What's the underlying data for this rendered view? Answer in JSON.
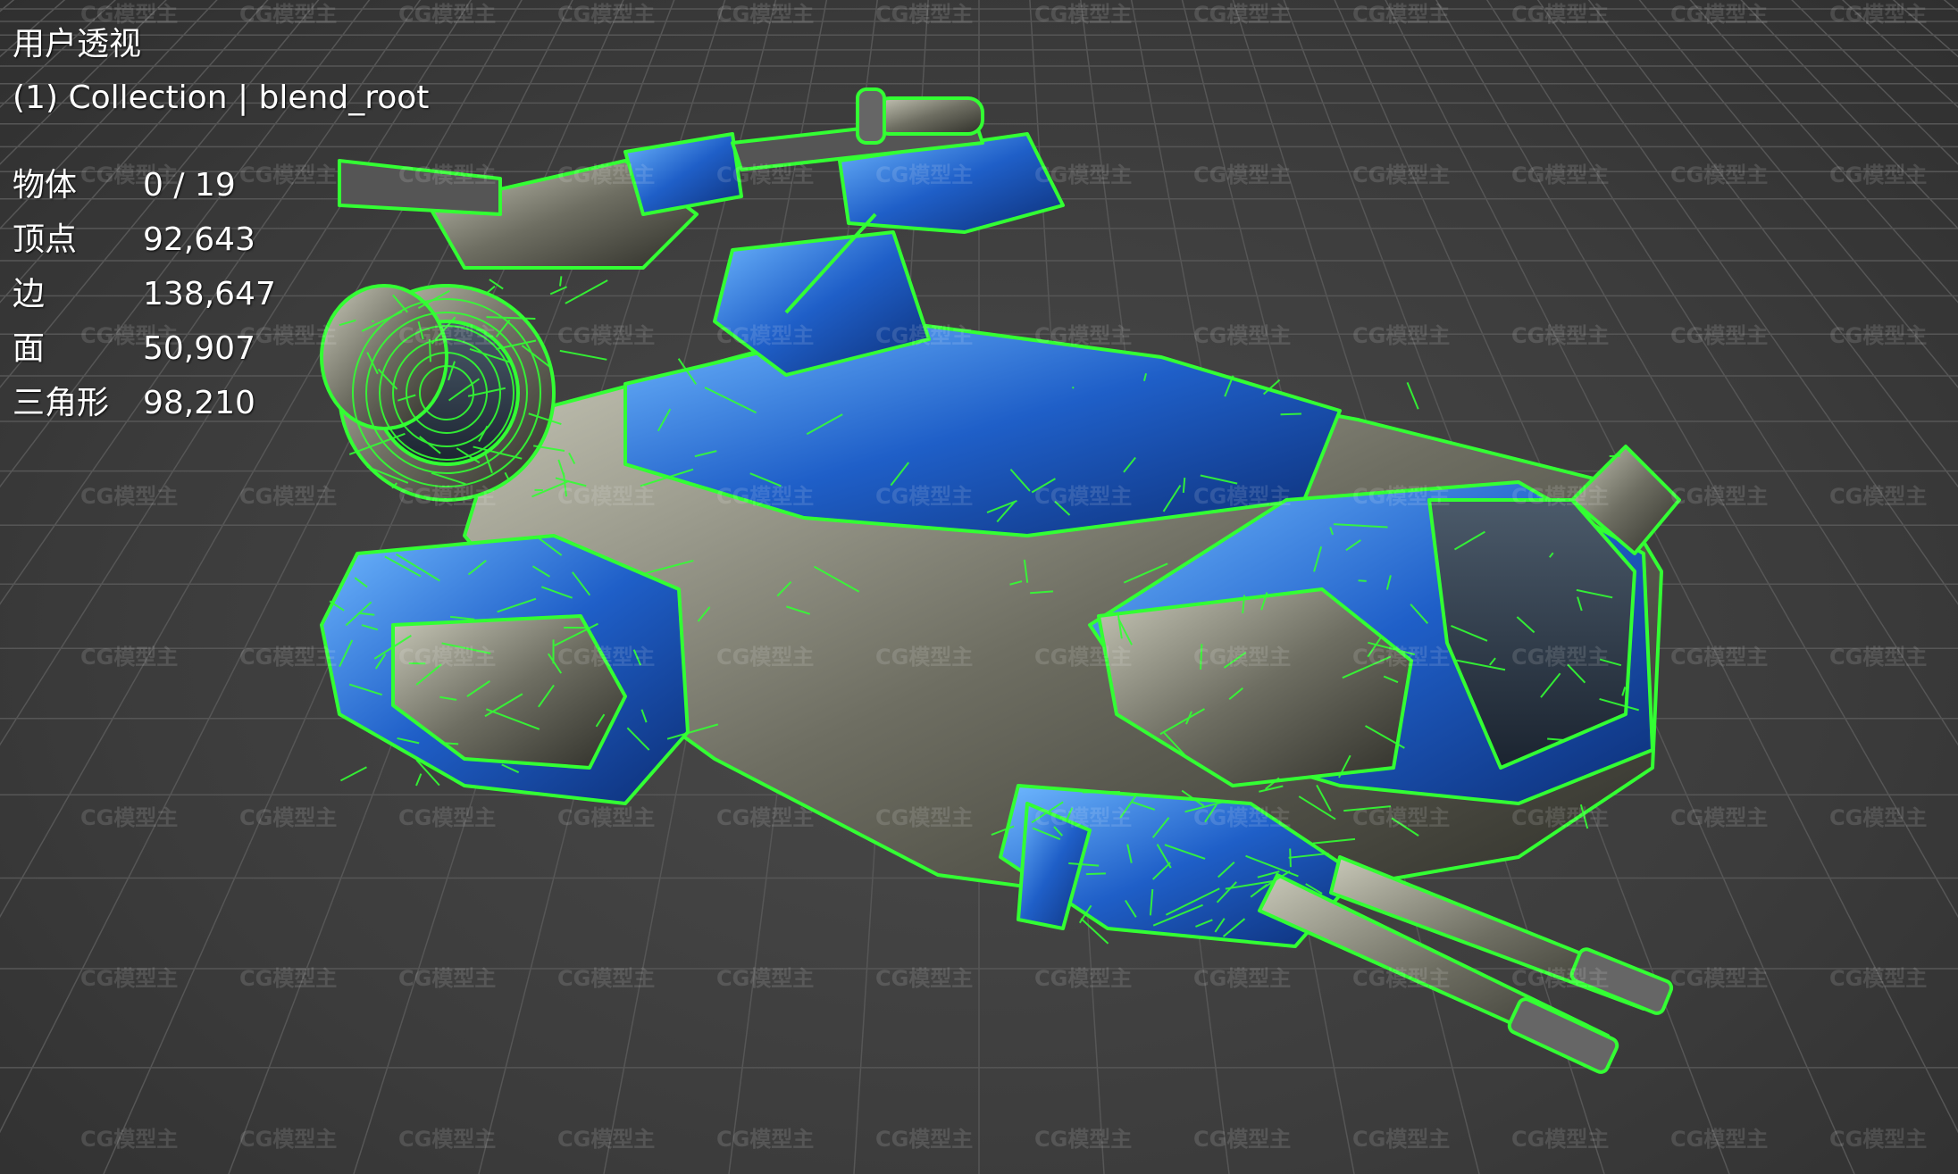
{
  "viewport": {
    "view_name": "用户透视",
    "collection": "(1) Collection | blend_root",
    "stats": [
      {
        "label": "物体",
        "value": "0 / 19"
      },
      {
        "label": "顶点",
        "value": "92,643"
      },
      {
        "label": "边",
        "value": "138,647"
      },
      {
        "label": "面",
        "value": "50,907"
      },
      {
        "label": "三角形",
        "value": "98,210"
      }
    ]
  },
  "watermark": {
    "text": "CG模型主"
  },
  "colors": {
    "background": "#3d3d3d",
    "grid": "#565656",
    "wireframe": "#33ff33",
    "hull_blue": "#2a6fd6",
    "hull_metal": "#8a8a7a"
  }
}
